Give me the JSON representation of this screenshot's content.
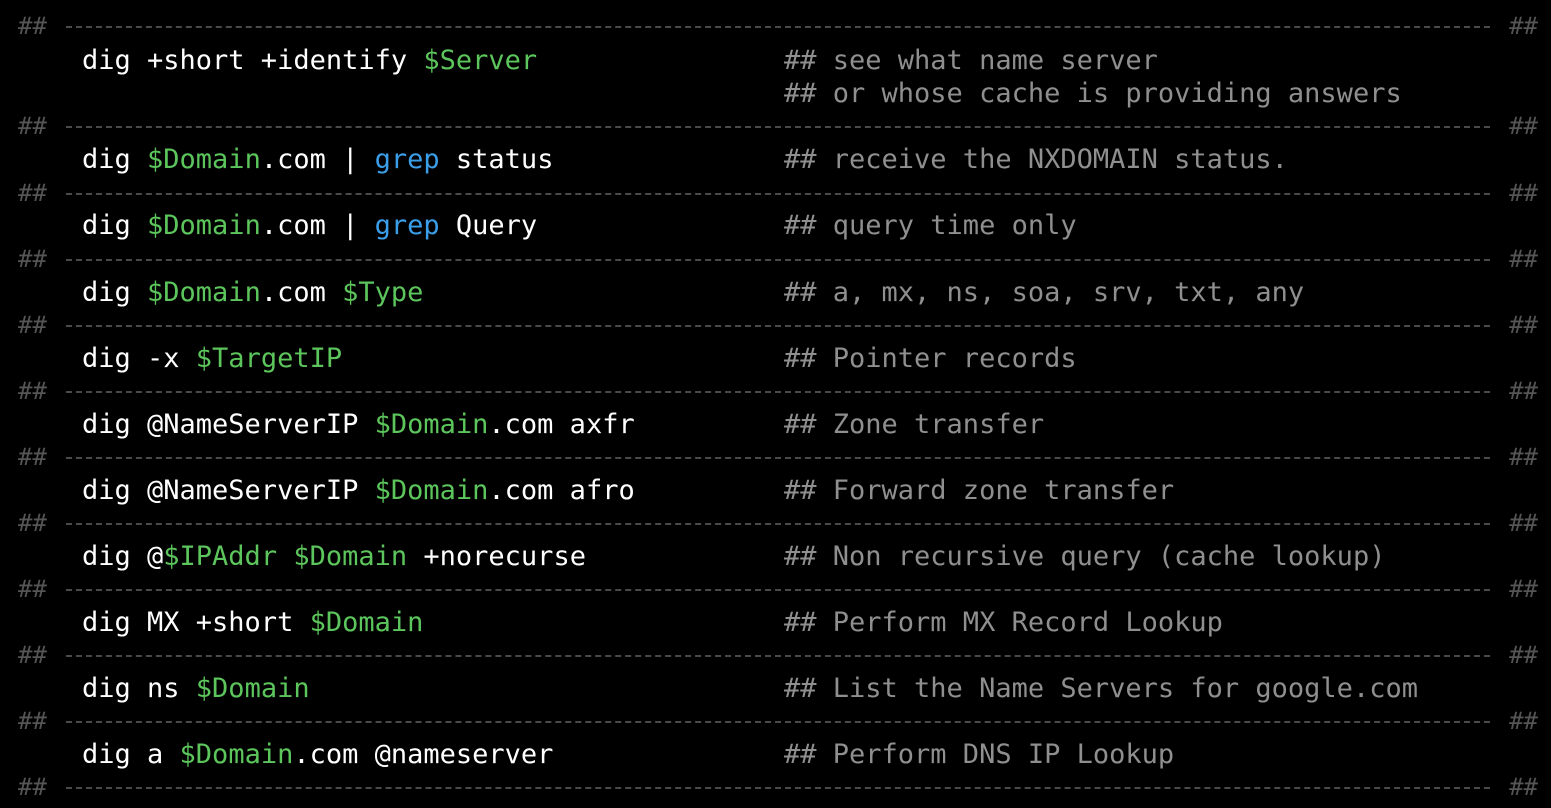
{
  "colors": {
    "background": "#000000",
    "plain": "#ffffff",
    "variable": "#5cc55c",
    "builtin": "#3b9ee8",
    "comment": "#8f8f8f",
    "separator": "#4a4a4a"
  },
  "separator_mark": "##",
  "rows": [
    {
      "command": [
        {
          "text": "dig +short +identify ",
          "style": "plain"
        },
        {
          "text": "$Server",
          "style": "variable"
        }
      ],
      "comments": [
        "## see what name server",
        "## or whose cache is providing answers"
      ]
    },
    {
      "command": [
        {
          "text": "dig ",
          "style": "plain"
        },
        {
          "text": "$Domain",
          "style": "variable"
        },
        {
          "text": ".com | ",
          "style": "plain"
        },
        {
          "text": "grep",
          "style": "builtin"
        },
        {
          "text": " status",
          "style": "plain"
        }
      ],
      "comments": [
        "## receive the NXDOMAIN status."
      ]
    },
    {
      "command": [
        {
          "text": "dig ",
          "style": "plain"
        },
        {
          "text": "$Domain",
          "style": "variable"
        },
        {
          "text": ".com | ",
          "style": "plain"
        },
        {
          "text": "grep",
          "style": "builtin"
        },
        {
          "text": " Query",
          "style": "plain"
        }
      ],
      "comments": [
        "## query time only"
      ]
    },
    {
      "command": [
        {
          "text": "dig ",
          "style": "plain"
        },
        {
          "text": "$Domain",
          "style": "variable"
        },
        {
          "text": ".com ",
          "style": "plain"
        },
        {
          "text": "$Type",
          "style": "variable"
        }
      ],
      "comments": [
        "## a, mx, ns, soa, srv, txt, any"
      ]
    },
    {
      "command": [
        {
          "text": "dig -x ",
          "style": "plain"
        },
        {
          "text": "$TargetIP",
          "style": "variable"
        }
      ],
      "comments": [
        "## Pointer records"
      ]
    },
    {
      "command": [
        {
          "text": "dig @NameServerIP ",
          "style": "plain"
        },
        {
          "text": "$Domain",
          "style": "variable"
        },
        {
          "text": ".com axfr",
          "style": "plain"
        }
      ],
      "comments": [
        "## Zone transfer"
      ]
    },
    {
      "command": [
        {
          "text": "dig @NameServerIP ",
          "style": "plain"
        },
        {
          "text": "$Domain",
          "style": "variable"
        },
        {
          "text": ".com afro",
          "style": "plain"
        }
      ],
      "comments": [
        "## Forward zone transfer"
      ]
    },
    {
      "command": [
        {
          "text": "dig @",
          "style": "plain"
        },
        {
          "text": "$IPAddr",
          "style": "variable"
        },
        {
          "text": " ",
          "style": "plain"
        },
        {
          "text": "$Domain",
          "style": "variable"
        },
        {
          "text": " +norecurse",
          "style": "plain"
        }
      ],
      "comments": [
        "## Non recursive query (cache lookup)"
      ]
    },
    {
      "command": [
        {
          "text": "dig MX +short ",
          "style": "plain"
        },
        {
          "text": "$Domain",
          "style": "variable"
        }
      ],
      "comments": [
        "## Perform MX Record Lookup"
      ]
    },
    {
      "command": [
        {
          "text": "dig ns ",
          "style": "plain"
        },
        {
          "text": "$Domain",
          "style": "variable"
        }
      ],
      "comments": [
        "## List the Name Servers for google.com"
      ]
    },
    {
      "command": [
        {
          "text": "dig a ",
          "style": "plain"
        },
        {
          "text": "$Domain",
          "style": "variable"
        },
        {
          "text": ".com @nameserver",
          "style": "plain"
        }
      ],
      "comments": [
        "## Perform DNS IP Lookup"
      ]
    }
  ]
}
